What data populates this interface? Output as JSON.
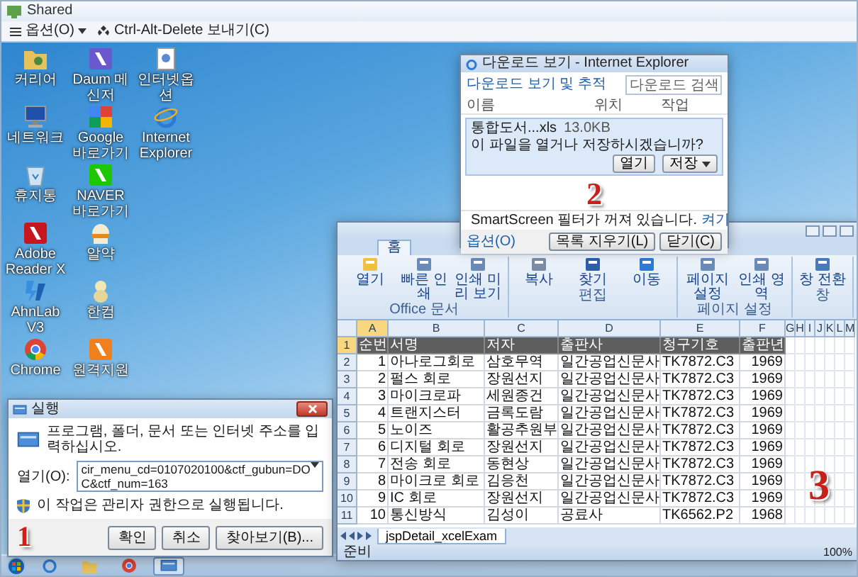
{
  "window": {
    "title": "Shared"
  },
  "toolbar": [
    {
      "kind": "menu",
      "label": "옵션(O)"
    },
    {
      "kind": "action",
      "label": "Ctrl-Alt-Delete 보내기(C)"
    }
  ],
  "desktop_icons": [
    {
      "label": "커리어"
    },
    {
      "label": "네트워크"
    },
    {
      "label": "휴지통"
    },
    {
      "label": "Adobe Reader X"
    },
    {
      "label": "AhnLab V3"
    },
    {
      "label": "Chrome"
    },
    {
      "label": "Daum 메신저"
    },
    {
      "label": "Google 바로가기"
    },
    {
      "label": "NAVER 바로가기"
    },
    {
      "label": "알약"
    },
    {
      "label": "한컴"
    },
    {
      "label": "원격지원"
    },
    {
      "label": "인터넷옵션"
    },
    {
      "label": "Internet Explorer"
    }
  ],
  "run_dialog": {
    "title": "실행",
    "message": "프로그램, 폴더, 문서 또는 인터넷 주소를 입력하십시오.",
    "open_label": "열기(O):",
    "value": "cir_menu_cd=0107020100&ctf_gubun=DOC&ctf_num=163",
    "note": "이 작업은 관리자 권한으로 실행됩니다.",
    "buttons": [
      "확인",
      "취소",
      "찾아보기(B)..."
    ],
    "annotation": "1"
  },
  "download_window": {
    "title": "다운로드 보기 - Internet Explorer",
    "heading": "다운로드 보기 및 추적",
    "search": {
      "placeholder": "다운로드 검색"
    },
    "columns": [
      "이름",
      "위치",
      "작업"
    ],
    "items": [
      {
        "name": "통합도서...xls",
        "size": "13.0KB",
        "message": "이 파일을 열거나 저장하시겠습니까?",
        "actions": [
          "열기",
          "저장"
        ]
      }
    ],
    "smartscreen": "SmartScreen 필터가 꺼져 있습니다.",
    "smartscreen_action": "켜기",
    "options_link": "옵션(O)",
    "buttons": [
      "목록 지우기(L)",
      "닫기(C)"
    ],
    "annotation": "2"
  },
  "excel": {
    "tabs": [
      {
        "label": "홈",
        "selected": true
      }
    ],
    "ribbon_groups": [
      {
        "label": "Office 문서",
        "buttons": [
          "열기",
          "빠른 인쇄",
          "인쇄 미리 보기"
        ]
      },
      {
        "label": "편집",
        "buttons": [
          "복사",
          "찾기",
          "이동"
        ]
      },
      {
        "label": "페이지 설정",
        "buttons": [
          "페이지 설정",
          "인쇄 영역"
        ]
      },
      {
        "label": "창",
        "buttons": [
          "창 전환"
        ]
      }
    ],
    "columns": [
      "A",
      "B",
      "C",
      "D",
      "E",
      "F",
      "G",
      "H",
      "I",
      "J",
      "K",
      "L",
      "M"
    ],
    "rows": [
      {
        "kind": "header",
        "number": "1",
        "cells": [
          "순번",
          "서명",
          "저자",
          "출판사",
          "청구기호",
          "출판년"
        ]
      },
      {
        "kind": "data",
        "number": "2",
        "cells": [
          "1",
          "아나로그회로",
          "삼호무역",
          "일간공업신문사",
          "TK7872.C3",
          "1969"
        ]
      },
      {
        "kind": "data",
        "number": "3",
        "cells": [
          "2",
          "펄스 회로",
          "장원선지",
          "일간공업신문사",
          "TK7872.C3",
          "1969"
        ]
      },
      {
        "kind": "data",
        "number": "4",
        "cells": [
          "3",
          "마이크로파",
          "세원종건",
          "일간공업신문사",
          "TK7872.C3",
          "1969"
        ]
      },
      {
        "kind": "data",
        "number": "5",
        "cells": [
          "4",
          "트랜지스터",
          "금록도람",
          "일간공업신문사",
          "TK7872.C3",
          "1969"
        ]
      },
      {
        "kind": "data",
        "number": "6",
        "cells": [
          "5",
          "노이즈",
          "활공추원부",
          "일간공업신문사",
          "TK7872.C3",
          "1969"
        ]
      },
      {
        "kind": "data",
        "number": "7",
        "cells": [
          "6",
          "디지털 회로",
          "장원선지",
          "일간공업신문사",
          "TK7872.C3",
          "1969"
        ]
      },
      {
        "kind": "data",
        "number": "8",
        "cells": [
          "7",
          "전송 회로",
          "동현상",
          "일간공업신문사",
          "TK7872.C3",
          "1969"
        ]
      },
      {
        "kind": "data",
        "number": "9",
        "cells": [
          "8",
          "마이크로 회로",
          "김응천",
          "일간공업신문사",
          "TK7872.C3",
          "1969"
        ]
      },
      {
        "kind": "data",
        "number": "10",
        "cells": [
          "9",
          "IC 회로",
          "장원선지",
          "일간공업신문사",
          "TK7872.C3",
          "1969"
        ]
      },
      {
        "kind": "data",
        "number": "11",
        "cells": [
          "10",
          "통신방식",
          "김성이",
          "공료사",
          "TK6562.P2",
          "1968"
        ]
      }
    ],
    "sheet_tab": "jspDetail_xcelExam",
    "status": "준비",
    "zoom": "100%",
    "annotation": "3"
  },
  "taskbar": [
    {
      "active": false
    },
    {
      "active": false
    },
    {
      "active": false
    },
    {
      "active": true
    }
  ]
}
